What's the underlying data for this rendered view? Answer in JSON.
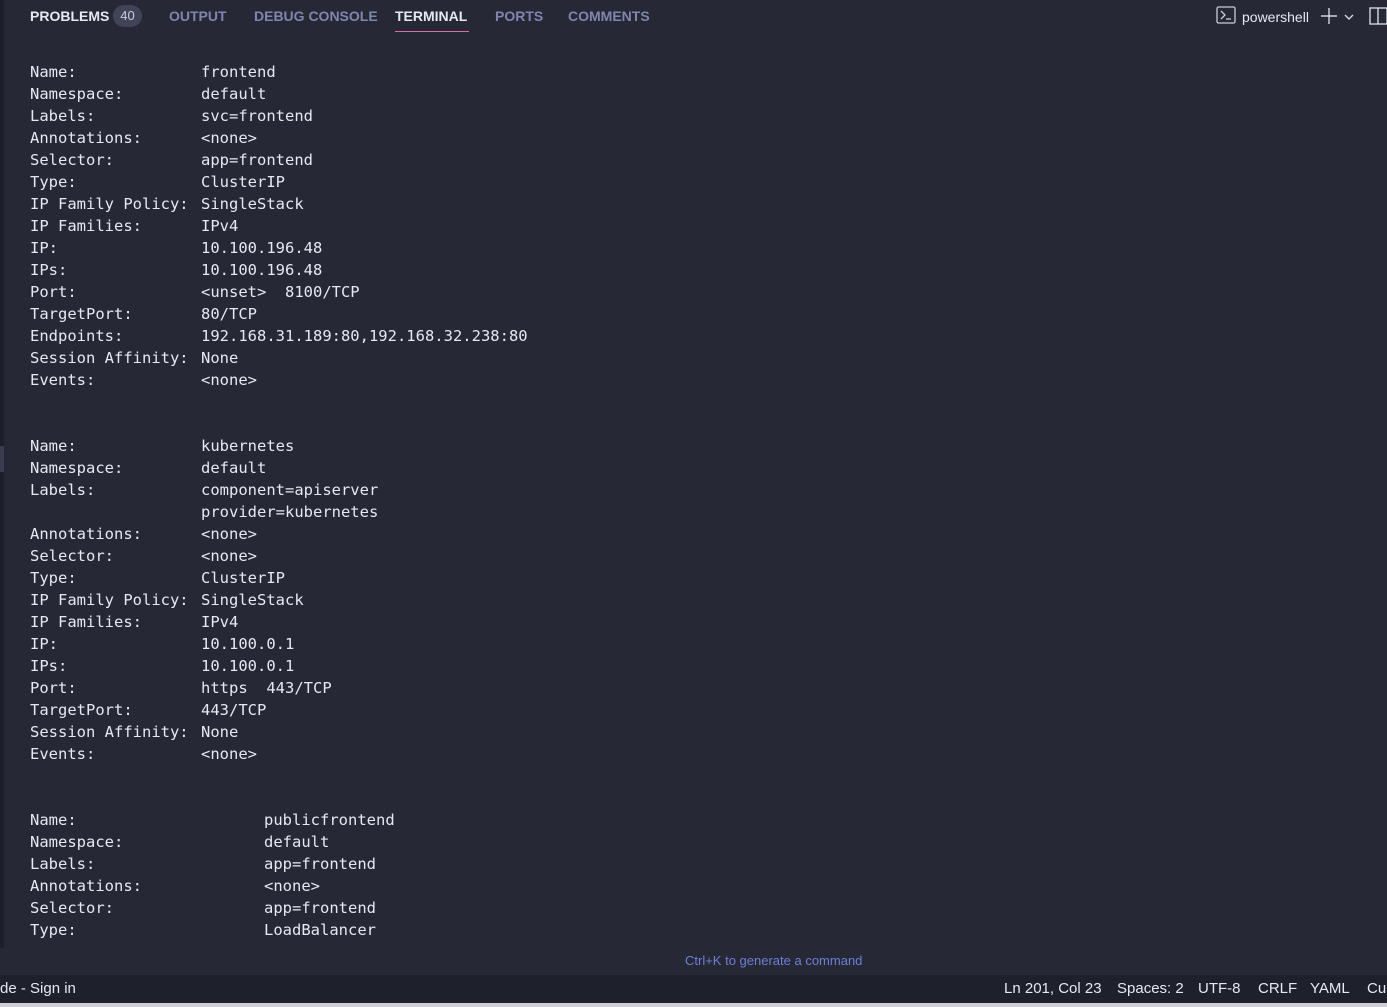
{
  "panel": {
    "tabs": [
      {
        "label": "PROBLEMS",
        "badge": "40"
      },
      {
        "label": "OUTPUT"
      },
      {
        "label": "DEBUG CONSOLE"
      },
      {
        "label": "TERMINAL",
        "active": true
      },
      {
        "label": "PORTS"
      },
      {
        "label": "COMMENTS"
      }
    ],
    "terminal_profile": "powershell",
    "icons": [
      "terminal-icon",
      "plus-icon",
      "chevron-down-icon",
      "split-panel-icon"
    ],
    "accent_color": "#d66fa8"
  },
  "terminal": {
    "services": [
      {
        "rows": [
          [
            "Name:",
            "frontend"
          ],
          [
            "Namespace:",
            "default"
          ],
          [
            "Labels:",
            "svc=frontend"
          ],
          [
            "Annotations:",
            "<none>"
          ],
          [
            "Selector:",
            "app=frontend"
          ],
          [
            "Type:",
            "ClusterIP"
          ],
          [
            "IP Family Policy:",
            "SingleStack"
          ],
          [
            "IP Families:",
            "IPv4"
          ],
          [
            "IP:",
            "10.100.196.48"
          ],
          [
            "IPs:",
            "10.100.196.48"
          ],
          [
            "Port:",
            "<unset>  8100/TCP"
          ],
          [
            "TargetPort:",
            "80/TCP"
          ],
          [
            "Endpoints:",
            "192.168.31.189:80,192.168.32.238:80"
          ],
          [
            "Session Affinity:",
            "None"
          ],
          [
            "Events:",
            "<none>"
          ]
        ]
      },
      {
        "rows": [
          [
            "Name:",
            "kubernetes"
          ],
          [
            "Namespace:",
            "default"
          ],
          [
            "Labels:",
            "component=apiserver"
          ],
          [
            "",
            "provider=kubernetes"
          ],
          [
            "Annotations:",
            "<none>"
          ],
          [
            "Selector:",
            "<none>"
          ],
          [
            "Type:",
            "ClusterIP"
          ],
          [
            "IP Family Policy:",
            "SingleStack"
          ],
          [
            "IP Families:",
            "IPv4"
          ],
          [
            "IP:",
            "10.100.0.1"
          ],
          [
            "IPs:",
            "10.100.0.1"
          ],
          [
            "Port:",
            "https  443/TCP"
          ],
          [
            "TargetPort:",
            "443/TCP"
          ],
          [
            "Session Affinity:",
            "None"
          ],
          [
            "Events:",
            "<none>"
          ]
        ]
      },
      {
        "rows": [
          [
            "Name:",
            "publicfrontend"
          ],
          [
            "Namespace:",
            "default"
          ],
          [
            "Labels:",
            "app=frontend"
          ],
          [
            "Annotations:",
            "<none>"
          ],
          [
            "Selector:",
            "app=frontend"
          ],
          [
            "Type:",
            "LoadBalancer"
          ]
        ]
      }
    ],
    "hint": "Ctrl+K to generate a command"
  },
  "statusbar": {
    "left": "de - Sign in",
    "position": "Ln 201, Col 23",
    "indent": "Spaces: 2",
    "encoding": "UTF-8",
    "eol": "CRLF",
    "language": "YAML",
    "truncated": "Cu"
  }
}
